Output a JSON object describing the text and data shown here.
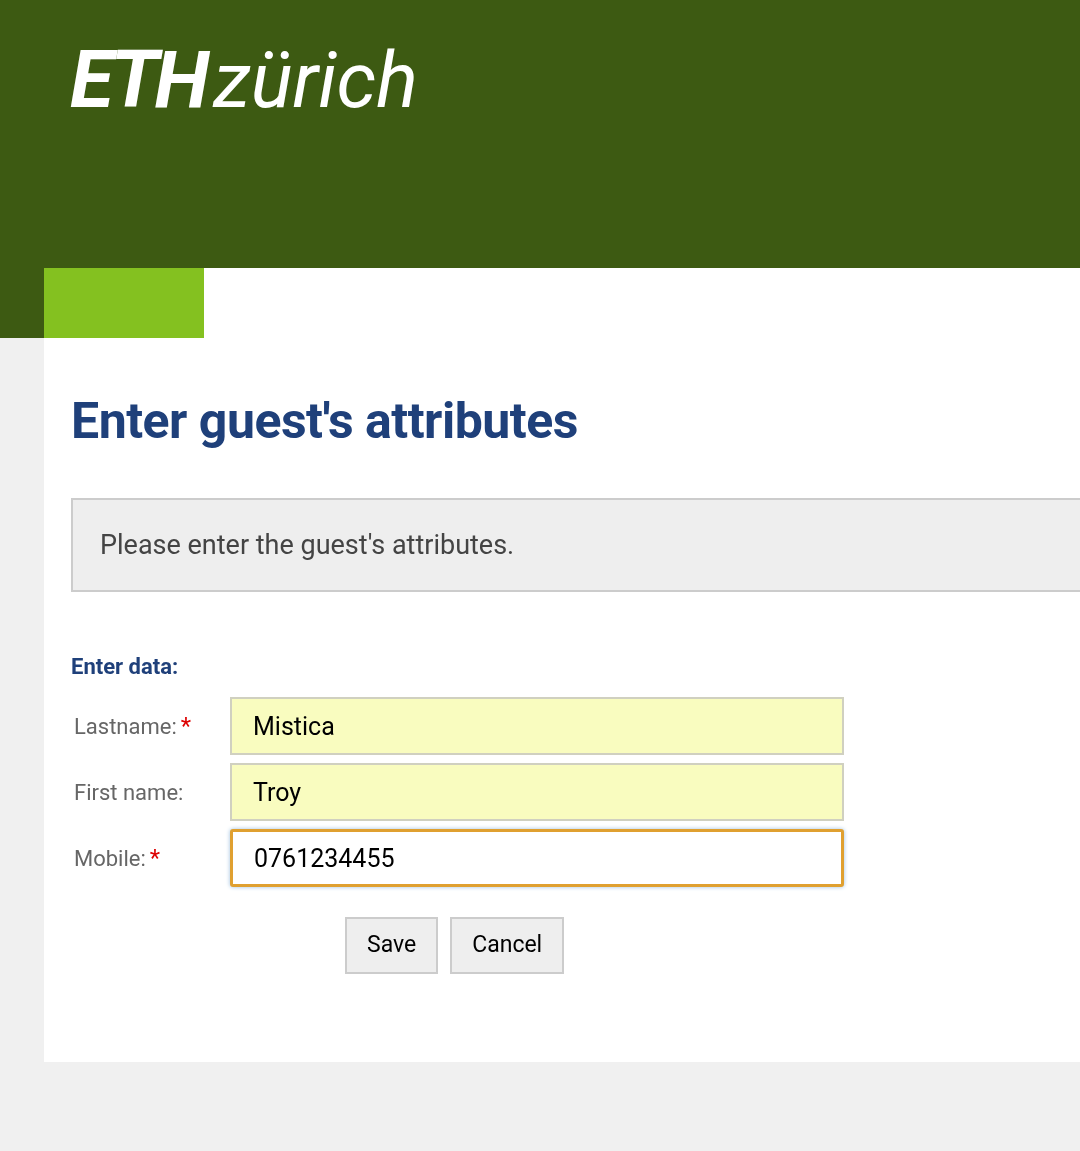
{
  "logo": {
    "mark": "ETH",
    "word": "zürich"
  },
  "title": "Enter guest's attributes",
  "info": "Please enter the guest's attributes.",
  "form": {
    "heading": "Enter data:",
    "fields": [
      {
        "label": "Lastname:",
        "required_mark": "*",
        "value": "Mistica",
        "autofilled": true,
        "focused": false
      },
      {
        "label": "First name:",
        "value": "Troy",
        "autofilled": true,
        "focused": false
      },
      {
        "label": "Mobile:",
        "required_mark": "*",
        "value": "0761234455",
        "autofilled": false,
        "focused": true
      }
    ],
    "buttons": [
      "Save",
      "Cancel"
    ]
  }
}
